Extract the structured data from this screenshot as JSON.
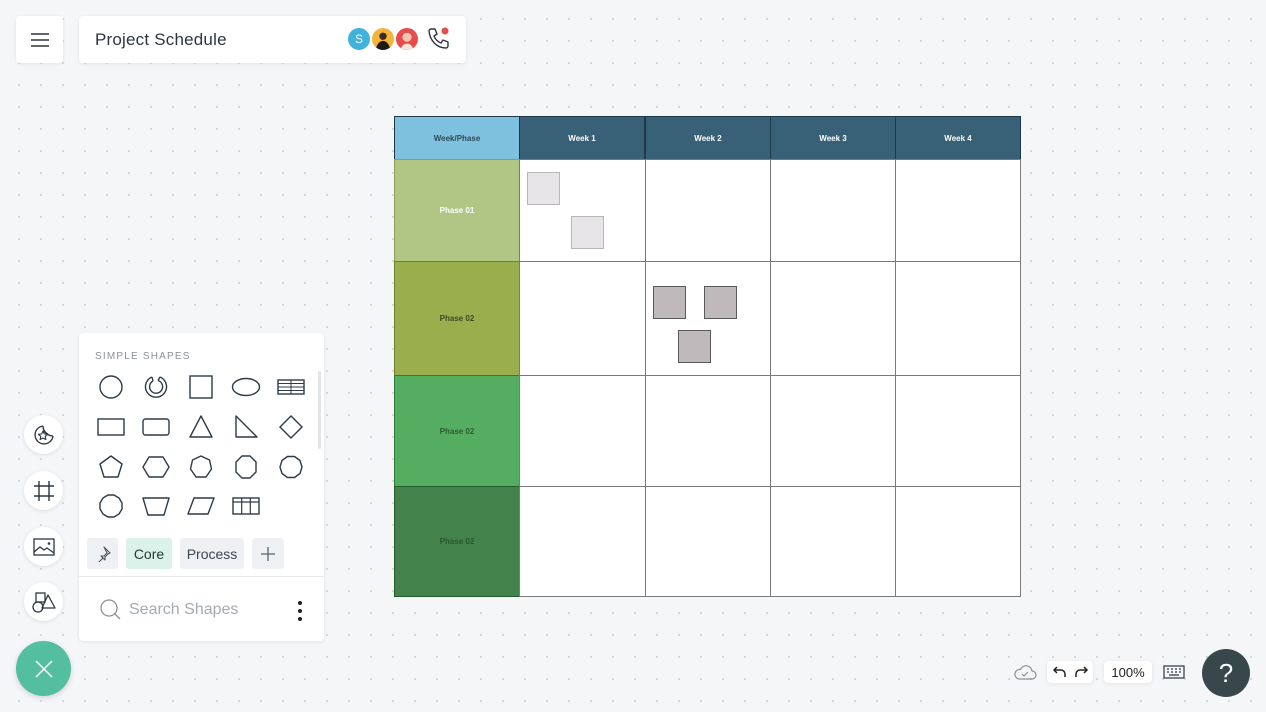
{
  "header": {
    "title": "Project Schedule",
    "collaborators": [
      {
        "initial": "S",
        "color": "#3fb3dd"
      },
      {
        "initial": "",
        "color": "#f4b43c"
      },
      {
        "initial": "",
        "color": "#e84b4b"
      }
    ],
    "call_badge_color": "#e84b4b"
  },
  "table": {
    "corner_label": "Week/Phase",
    "columns": [
      "Week 1",
      "Week 2",
      "Week 3",
      "Week 4"
    ],
    "rows": [
      {
        "label": "Phase 01",
        "color": "#b1c685",
        "text_color": "#ffffff"
      },
      {
        "label": "Phase 02",
        "color": "#9bae4d",
        "text_color": "#3e4a22"
      },
      {
        "label": "Phase 02",
        "color": "#55ad62",
        "text_color": "#2f5a35"
      },
      {
        "label": "Phase 02",
        "color": "#43834b",
        "text_color": "#2d5532"
      }
    ],
    "header_color": "#386178",
    "corner_color": "#7dc1de",
    "sticky_notes": [
      {
        "row": 0,
        "col": 0,
        "color": "#e7e5e7"
      },
      {
        "row": 0,
        "col": 0,
        "color": "#e7e5e7"
      },
      {
        "row": 1,
        "col": 1,
        "color": "#c0b9bb"
      },
      {
        "row": 1,
        "col": 1,
        "color": "#c0b9bb"
      },
      {
        "row": 1,
        "col": 1,
        "color": "#c0b9bb"
      }
    ]
  },
  "shapes_panel": {
    "heading": "SIMPLE SHAPES",
    "shapes": [
      "circle",
      "arc",
      "square",
      "ellipse",
      "table",
      "rectangle",
      "rounded-rectangle",
      "triangle",
      "right-triangle",
      "diamond",
      "pentagon",
      "hexagon",
      "heptagon",
      "octagon",
      "decagon",
      "dodecagon",
      "trapezoid",
      "parallelogram",
      "grid"
    ],
    "tabs": [
      "Core",
      "Process"
    ],
    "active_tab": "Core",
    "search_placeholder": "Search Shapes"
  },
  "left_rail": [
    "sticker",
    "frame",
    "image",
    "shapes"
  ],
  "bottom_bar": {
    "zoom": "100%",
    "help": "?"
  },
  "accent": "#54bf9e"
}
